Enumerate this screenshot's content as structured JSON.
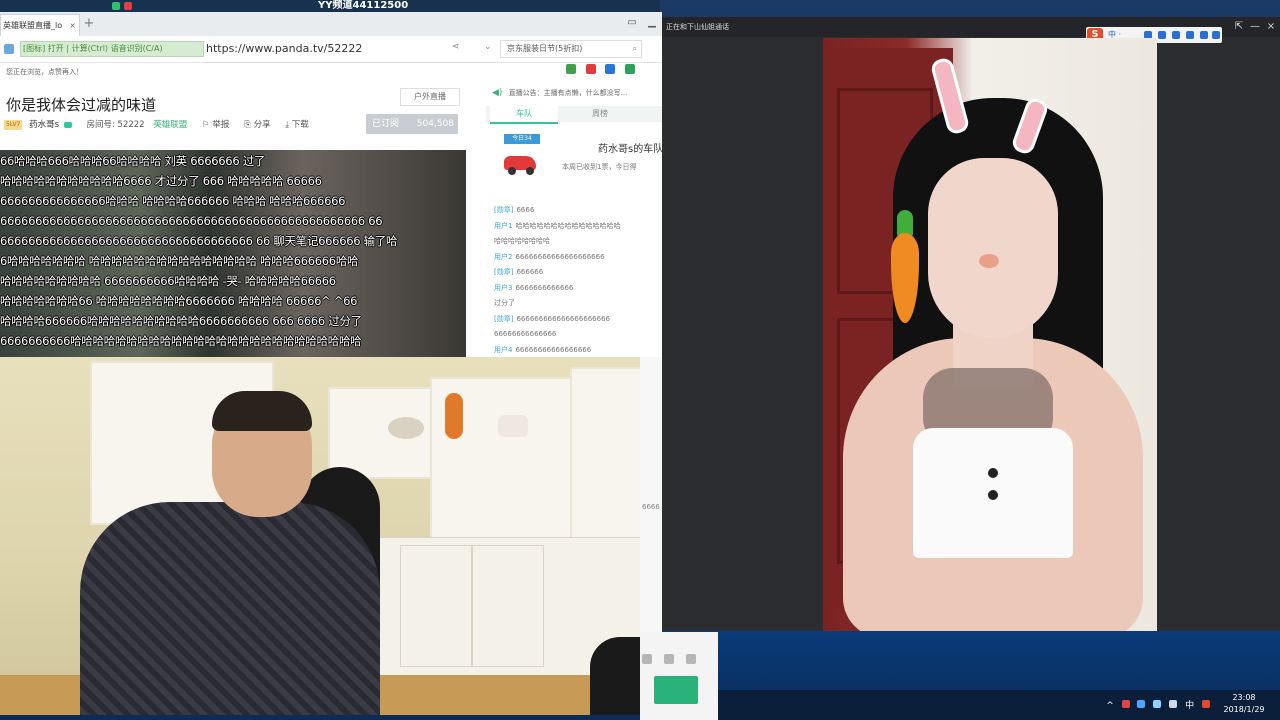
{
  "yy_title": "YY频道44112500",
  "browser": {
    "tab_title": "英雄联盟直播_lo",
    "tab_close": "×",
    "new_tab": "+",
    "green_bar": "[图标] 打开 | 计算(Ctrl) 语音识别(C/A)",
    "url": "https://www.panda.tv/52222",
    "search_text": "京东服装日节(5折扣)",
    "notice": "您正在浏览，点赞再入！",
    "win_restore": "▭",
    "win_min": "▁"
  },
  "room": {
    "title": "你是我体会过减的味道",
    "category": "户外直播",
    "badge": "5LV7",
    "host": "药水哥s",
    "room_label": "房间号: 52222",
    "game": "英雄联盟",
    "report": "举报",
    "share": "分享",
    "download": "下载",
    "follow_label": "已订阅",
    "follow_count": "504,508"
  },
  "danmaku": [
    "66哈哈哈666哈哈哈66哈哈哈哈  刘英    6666666  过了",
    "哈哈哈哈哈哈哈哈哈哈哈6666  才过分了  666    哈哈哈哈哈  66666",
    "666666666666666哈哈哈 哈哈哈哈666666  哈哈哈  哈哈哈666666",
    "6666666666666666666666666666666666666666666666666666  66",
    "666666666666666666666666666666666666  66  聊天笔记666666  输了哈",
    "6哈哈哈哈哈哈哈  哈哈哈哈哈哈哈哈哈哈哈哈哈哈哈  哈哈哈666666哈哈",
    "哈哈哈哈哈哈哈哈哈  6666666666哈哈哈哈  -哭-  哈哈哈哈哈66666",
    "哈哈哈哈哈哈哈66  哈哈哈哈哈哈哈哈6666666  哈哈哈哈  66666^  ^66",
    "哈哈哈哈666666哈哈哈哈哈哈哈哈哈哈6666666666  666  6666  过分了",
    "6666666666哈哈哈哈哈哈哈哈哈哈哈哈哈哈哈哈哈哈哈哈哈哈哈哈哈哈"
  ],
  "chat": {
    "broadcast": "直播公告：主播有点懒，什么都没写...",
    "tab1": "车队",
    "tab2": "周榜",
    "day_tag": "今日34",
    "car_name": "药水哥s的车队",
    "car_sub": "本周已收到1票，今日得",
    "messages": [
      {
        "nick": "[勋章]",
        "text": "6666"
      },
      {
        "nick": "用户1",
        "text": "哈哈哈哈哈哈哈哈哈哈哈哈哈哈哈"
      },
      {
        "nick": "",
        "text": "哈哈哈哈哈哈哈哈"
      },
      {
        "nick": "用户2",
        "text": "66666666666666666666"
      },
      {
        "nick": "[勋章]",
        "text": "666666"
      },
      {
        "nick": "用户3",
        "text": "6666666666666"
      },
      {
        "nick": "",
        "text": "过分了"
      },
      {
        "nick": "[勋章]",
        "text": "666666666666666666666"
      },
      {
        "nick": "",
        "text": "66666666666666"
      },
      {
        "nick": "用户4",
        "text": "66666666666666666"
      }
    ]
  },
  "video_window": {
    "title": "正在和下山仙姐通话",
    "logo": "S",
    "toolbar_text": "中 ·",
    "pin": "⇱",
    "minimize": "—",
    "close": "×"
  },
  "side_partial": "6666",
  "taskbar": {
    "tray_icons": [
      "^",
      "中"
    ],
    "time": "23:08",
    "date": "2018/1/29"
  }
}
